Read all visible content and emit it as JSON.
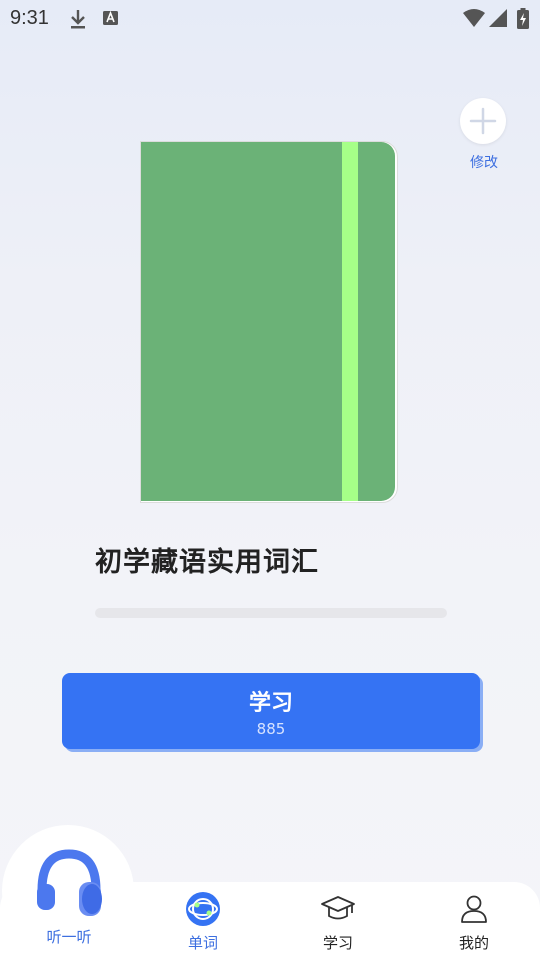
{
  "status_bar": {
    "time": "9:31",
    "icons": [
      "download-icon",
      "keyboard-a-icon",
      "wifi-icon",
      "signal-icon",
      "battery-charging-icon"
    ]
  },
  "edit": {
    "label": "修改",
    "icon": "plus-icon"
  },
  "book": {
    "title": "初学藏语实用词汇",
    "cover_color": "#6bb277",
    "strap_color": "#a6ff88",
    "progress": 0
  },
  "study_button": {
    "label": "学习",
    "count": "885"
  },
  "bottom_nav": {
    "listen": {
      "label": "听一听",
      "icon": "headphones-icon"
    },
    "items": [
      {
        "label": "单词",
        "icon": "globe-book-icon",
        "active": true
      },
      {
        "label": "学习",
        "icon": "graduation-cap-icon",
        "active": false
      },
      {
        "label": "我的",
        "icon": "person-icon",
        "active": false
      }
    ]
  },
  "colors": {
    "accent": "#3573f3",
    "label_blue": "#3d6fe0"
  }
}
